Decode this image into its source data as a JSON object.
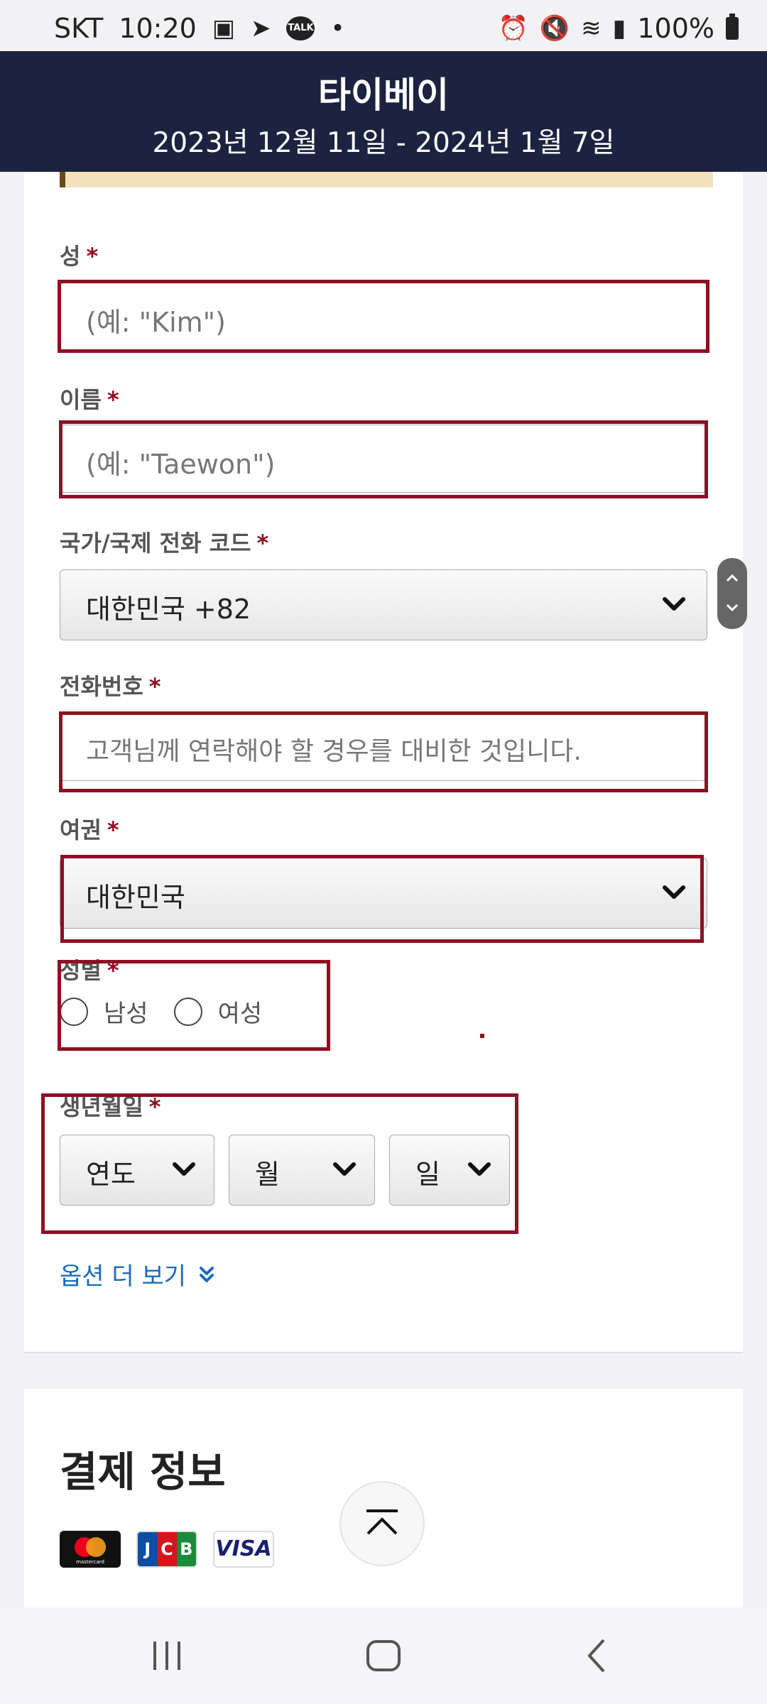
{
  "status_bar": {
    "carrier": "SKT",
    "time": "10:20",
    "talk_badge": "TALK",
    "battery": "100%"
  },
  "header": {
    "title": "타이베이",
    "dates": "2023년 12월 11일 - 2024년 1월 7일"
  },
  "form": {
    "required_mark": "*",
    "last_name": {
      "label": "성",
      "placeholder": "(예: \"Kim\")"
    },
    "first_name": {
      "label": "이름",
      "placeholder": "(예: \"Taewon\")"
    },
    "country_code": {
      "label": "국가/국제 전화 코드",
      "value": "대한민국 +82"
    },
    "phone": {
      "label": "전화번호",
      "placeholder": "고객님께 연락해야 할 경우를 대비한 것입니다."
    },
    "passport": {
      "label": "여권",
      "value": "대한민국"
    },
    "gender": {
      "label": "성별",
      "options": [
        "남성",
        "여성"
      ]
    },
    "dob": {
      "label": "생년월일",
      "year": "연도",
      "month": "월",
      "day": "일"
    },
    "more_options": "옵션 더 보기"
  },
  "payment": {
    "title": "결제 정보",
    "card_brands": [
      "mastercard",
      "JCB",
      "VISA"
    ]
  },
  "colors": {
    "header_bg": "#1c2340",
    "highlight_border": "#8e1022",
    "link": "#1b6bbd",
    "notice_bg": "#f3e1bd"
  }
}
